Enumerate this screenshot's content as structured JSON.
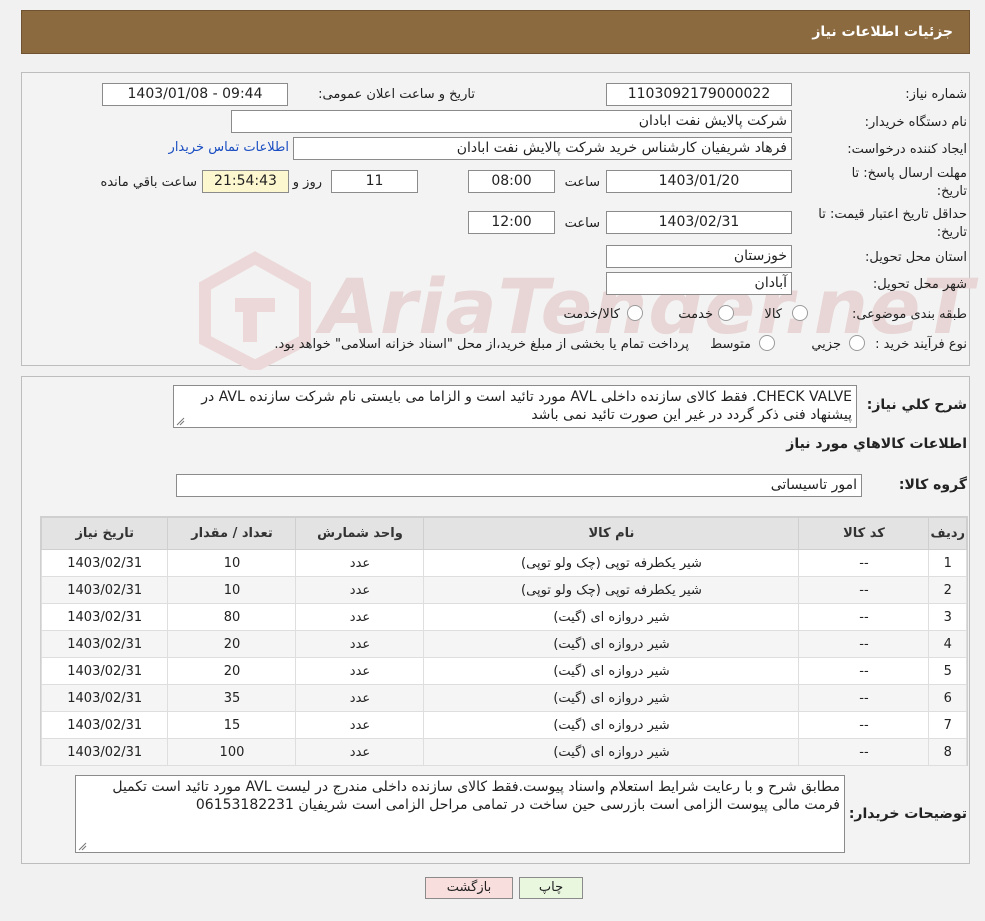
{
  "header": {
    "title": "جزئیات اطلاعات نیاز"
  },
  "watermark": {
    "text": "AriaTender.neT"
  },
  "form": {
    "need_number_label": "شماره نیاز:",
    "need_number": "1103092179000022",
    "announce_label": "تاریخ و ساعت اعلان عمومی:",
    "announce_value": "1403/01/08 - 09:44",
    "buyer_org_label": "نام دستگاه خریدار:",
    "buyer_org": "شرکت پالایش نفت ابادان",
    "creator_label": "ایجاد کننده درخواست:",
    "creator": "فرهاد شریفیان کارشناس خرید شرکت پالایش نفت ابادان",
    "contact_link": "اطلاعات تماس خریدار",
    "deadline_label_1": "مهلت ارسال پاسخ: تا",
    "deadline_label_2": "تاریخ:",
    "deadline_date": "1403/01/20",
    "time_label": "ساعت",
    "deadline_time": "08:00",
    "days_value": "11",
    "days_label": "روز و",
    "remaining_time": "21:54:43",
    "remaining_label": "ساعت باقي مانده",
    "price_validity_label_1": "حداقل تاریخ اعتبار قیمت: تا",
    "price_validity_label_2": "تاریخ:",
    "price_validity_date": "1403/02/31",
    "price_validity_time": "12:00",
    "province_label": "استان محل تحویل:",
    "province": "خوزستان",
    "city_label": "شهر محل تحویل:",
    "city": "آبادان",
    "category_label": "طبقه بندی موضوعی:",
    "category_options": [
      "کالا",
      "خدمت",
      "کالا/خدمت"
    ],
    "purchase_type_label": "نوع فرآیند خرید :",
    "purchase_type_options": [
      "جزیي",
      "متوسط"
    ],
    "purchase_note": "پرداخت تمام یا بخشی از مبلغ خرید،از محل \"اسناد خزانه اسلامی\" خواهد بود."
  },
  "description": {
    "label": "شرح کلي نیاز:",
    "text": "CHECK VALVE. فقط کالای سازنده داخلی AVL مورد تائید است و الزاما می بایستی نام شرکت سازنده AVL در پیشنهاد فنی ذکر گردد در غیر این صورت تائید نمی باشد"
  },
  "goods": {
    "section_title": "اطلاعات کالاهاي مورد نیاز",
    "group_label": "گروه کالا:",
    "group_value": "امور تاسیساتی",
    "columns": [
      "ردیف",
      "کد کالا",
      "نام کالا",
      "واحد شمارش",
      "تعداد / مقدار",
      "تاریخ نیاز"
    ],
    "rows": [
      {
        "idx": "1",
        "code": "--",
        "name": "شیر یکطرفه توپی (چک ولو توپی)",
        "unit": "عدد",
        "qty": "10",
        "date": "1403/02/31"
      },
      {
        "idx": "2",
        "code": "--",
        "name": "شیر یکطرفه توپی (چک ولو توپی)",
        "unit": "عدد",
        "qty": "10",
        "date": "1403/02/31"
      },
      {
        "idx": "3",
        "code": "--",
        "name": "شیر دروازه ای (گیت)",
        "unit": "عدد",
        "qty": "80",
        "date": "1403/02/31"
      },
      {
        "idx": "4",
        "code": "--",
        "name": "شیر دروازه ای (گیت)",
        "unit": "عدد",
        "qty": "20",
        "date": "1403/02/31"
      },
      {
        "idx": "5",
        "code": "--",
        "name": "شیر دروازه ای (گیت)",
        "unit": "عدد",
        "qty": "20",
        "date": "1403/02/31"
      },
      {
        "idx": "6",
        "code": "--",
        "name": "شیر دروازه ای (گیت)",
        "unit": "عدد",
        "qty": "35",
        "date": "1403/02/31"
      },
      {
        "idx": "7",
        "code": "--",
        "name": "شیر دروازه ای (گیت)",
        "unit": "عدد",
        "qty": "15",
        "date": "1403/02/31"
      },
      {
        "idx": "8",
        "code": "--",
        "name": "شیر دروازه ای (گیت)",
        "unit": "عدد",
        "qty": "100",
        "date": "1403/02/31"
      }
    ]
  },
  "buyer_notes": {
    "label": "توضیحات خریدار:",
    "text": "مطابق شرح و با رعایت شرایط استعلام واسناد پیوست.فقط کالای سازنده داخلی مندرج در لیست AVL مورد تائید است تکمیل فرمت مالی پیوست الزامی است بازرسی حین ساخت در تمامی مراحل الزامی است شریفیان 06153182231"
  },
  "buttons": {
    "print": "چاپ",
    "back": "بازگشت"
  },
  "colors": {
    "header": "#8c6a3f",
    "print_button": "#e9f7df",
    "back_button": "#f9dede",
    "link": "#1a4ec2"
  }
}
